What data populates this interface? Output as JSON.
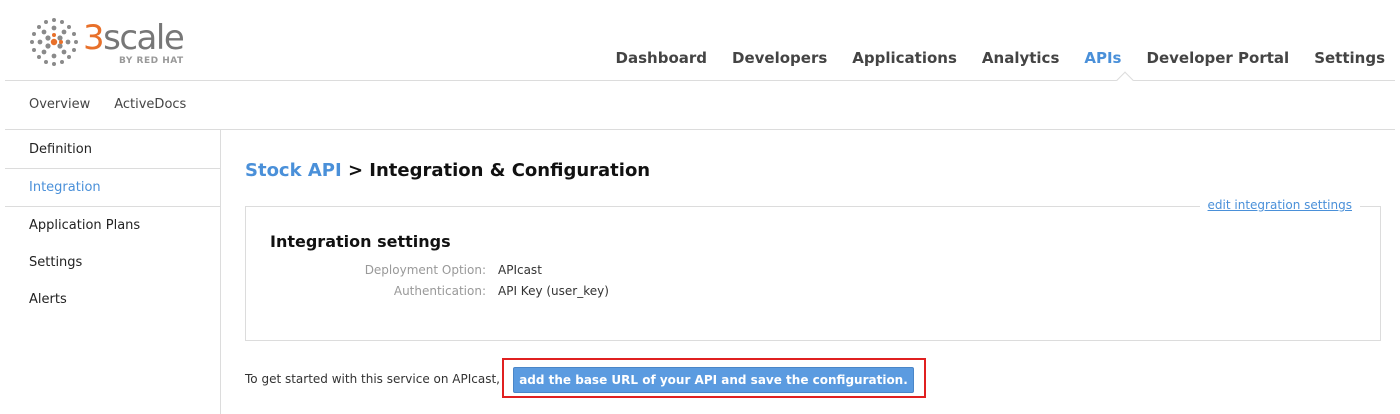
{
  "brand": {
    "name_prefix": "3",
    "name_rest": "scale",
    "sub": "BY RED HAT",
    "accent": "#e8702a",
    "link_color": "#4a90d9",
    "highlight_border": "#e02020"
  },
  "topnav": [
    {
      "label": "Dashboard",
      "active": false
    },
    {
      "label": "Developers",
      "active": false
    },
    {
      "label": "Applications",
      "active": false
    },
    {
      "label": "Analytics",
      "active": false
    },
    {
      "label": "APIs",
      "active": true
    },
    {
      "label": "Developer Portal",
      "active": false
    },
    {
      "label": "Settings",
      "active": false
    }
  ],
  "subnav": [
    {
      "label": "Overview"
    },
    {
      "label": "ActiveDocs"
    }
  ],
  "sidebar": [
    {
      "label": "Definition",
      "active": false
    },
    {
      "label": "Integration",
      "active": true
    },
    {
      "label": "Application Plans",
      "active": false
    },
    {
      "label": "Settings",
      "active": false
    },
    {
      "label": "Alerts",
      "active": false
    }
  ],
  "page": {
    "crumb": "Stock API",
    "separator": " > ",
    "title": "Integration & Configuration"
  },
  "panel": {
    "edit_link": "edit integration settings",
    "title": "Integration settings",
    "rows": [
      {
        "label": "Deployment Option:",
        "value": "APIcast"
      },
      {
        "label": "Authentication:",
        "value": "API Key (user_key)"
      }
    ]
  },
  "cta": {
    "text": "To get started with this service on APIcast,",
    "button": "add the base URL of your API and save the configuration."
  }
}
